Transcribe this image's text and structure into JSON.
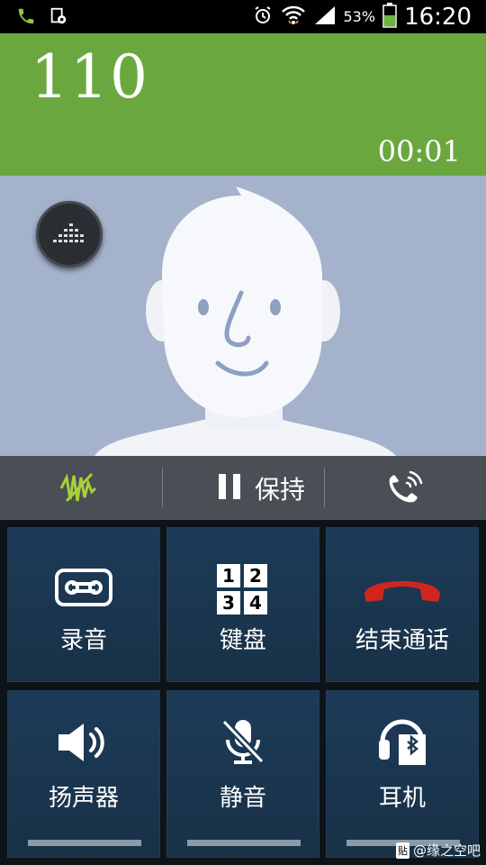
{
  "status_bar": {
    "battery_percent": "53%",
    "time": "16:20",
    "icons": [
      "phone-icon",
      "settings-doc-icon",
      "alarm-icon",
      "wifi-icon",
      "signal-icon",
      "battery-icon"
    ]
  },
  "call": {
    "number": "110",
    "duration": "00:01"
  },
  "controls": {
    "hold_label": "保持"
  },
  "actions": {
    "record_label": "录音",
    "keypad_label": "键盘",
    "end_call_label": "结束通话",
    "speaker_label": "扬声器",
    "mute_label": "静音",
    "headset_label": "耳机",
    "keypad_digits": [
      "1",
      "2",
      "3",
      "4"
    ]
  },
  "watermark": {
    "badge": "贴",
    "text": "@缘之空吧"
  },
  "colors": {
    "header_green": "#6aa83f",
    "end_call_red": "#d0261e",
    "tile_blue": "#1d3b58"
  }
}
